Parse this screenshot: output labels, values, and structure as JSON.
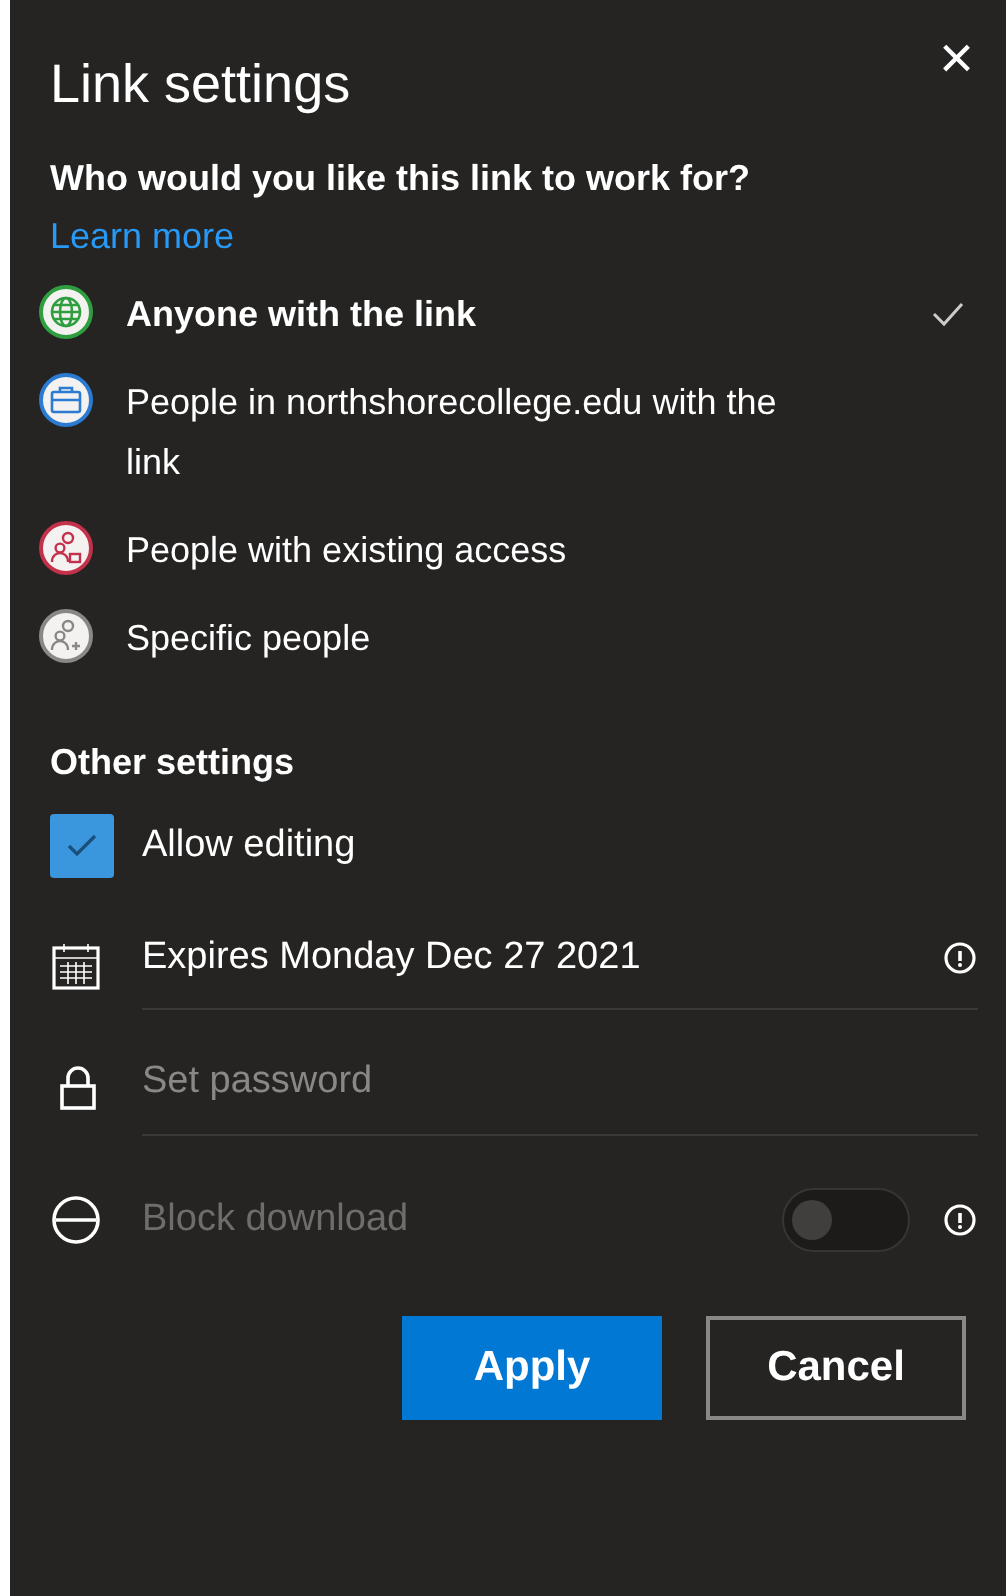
{
  "dialog": {
    "title": "Link settings",
    "close_label": "×"
  },
  "audience": {
    "question": "Who would you like this link to work for?",
    "learn_more": "Learn more",
    "options": [
      {
        "kind": "globe",
        "label": "Anyone with the link",
        "selected": true,
        "color": "#2e9e3e"
      },
      {
        "kind": "briefcase",
        "label": "People in northshorecollege.edu with the link",
        "selected": false,
        "color": "#2a7bd1"
      },
      {
        "kind": "people-lock",
        "label": "People with existing access",
        "selected": false,
        "color": "#c4314b"
      },
      {
        "kind": "people-add",
        "label": "Specific people",
        "selected": false,
        "color": "#8a8886"
      }
    ]
  },
  "other_settings": {
    "heading": "Other settings",
    "allow_editing": {
      "label": "Allow editing",
      "checked": true
    },
    "expiry": {
      "value": "Expires Monday Dec 27 2021"
    },
    "password": {
      "placeholder": "Set password"
    },
    "block_download": {
      "label": "Block download",
      "on": false,
      "disabled": true
    }
  },
  "buttons": [
    {
      "kind": "primary",
      "label": "Apply"
    },
    {
      "kind": "secondary",
      "label": "Cancel"
    }
  ]
}
